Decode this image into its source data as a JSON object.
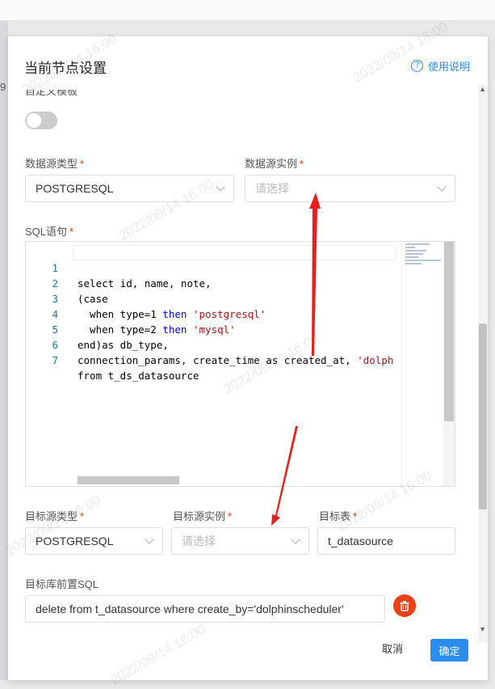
{
  "dialog": {
    "title": "当前节点设置",
    "help_label": "使用说明"
  },
  "form": {
    "custom_template_label": "自定义模板",
    "custom_template_enabled": false,
    "datasource_type_label": "数据源类型",
    "datasource_type_value": "POSTGRESQL",
    "datasource_instance_label": "数据源实例",
    "datasource_instance_placeholder": "请选择",
    "sql_label": "SQL语句",
    "target_type_label": "目标源类型",
    "target_type_value": "POSTGRESQL",
    "target_instance_label": "目标源实例",
    "target_instance_placeholder": "请选择",
    "target_table_label": "目标表",
    "target_table_value": "t_datasource",
    "pre_sql_label": "目标库前置SQL",
    "pre_sql_value": "delete from t_datasource where create_by='dolphinscheduler'"
  },
  "editor": {
    "lines": [
      {
        "no": "1",
        "text": "select id, name, note,"
      },
      {
        "no": "2",
        "text": "(case"
      },
      {
        "no": "3",
        "text": "  when type=1 then 'postgresql'"
      },
      {
        "no": "4",
        "text": "  when type=2 then 'mysql'"
      },
      {
        "no": "5",
        "text": "end)as db_type,"
      },
      {
        "no": "6",
        "text": "connection_params, create_time as created_at, 'dolph"
      },
      {
        "no": "7",
        "text": "from t_ds_datasource"
      }
    ]
  },
  "footer": {
    "cancel_label": "取消",
    "ok_label": "确定"
  },
  "watermark": "2022/09/14 16:00",
  "edge_text": "9",
  "colors": {
    "primary": "#2d8cf0",
    "required": "#ed4014",
    "delete": "#ed4014",
    "arrow": "#e8201b"
  }
}
